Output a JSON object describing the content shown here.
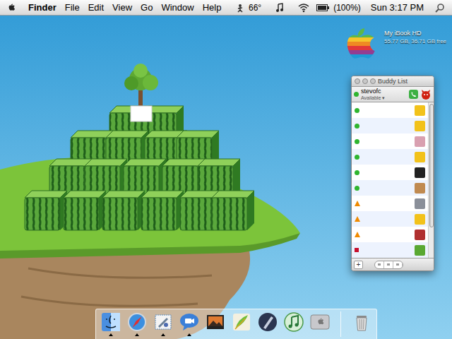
{
  "menu_bar": {
    "app": "Finder",
    "menus": [
      "File",
      "Edit",
      "View",
      "Go",
      "Window",
      "Help"
    ],
    "temperature": "66°",
    "battery": "(100%)",
    "clock": "Sun 3:17 PM"
  },
  "desktop_icons": [
    {
      "label": "My iBook HD",
      "detail": "55.77 GB, 36.71 GB free"
    }
  ],
  "buddy_list": {
    "title": "Buddy List",
    "focused": false,
    "account": {
      "name": "stevofc",
      "status": "Available",
      "status_menu": "▾",
      "color": "#2fb52f"
    },
    "buddies": [
      {
        "kind": "dot",
        "color": "#2fb52f"
      },
      {
        "kind": "dot",
        "color": "#2fb52f"
      },
      {
        "kind": "dot",
        "color": "#2fb52f"
      },
      {
        "kind": "dot",
        "color": "#2fb52f"
      },
      {
        "kind": "dot",
        "color": "#2fb52f"
      },
      {
        "kind": "dot",
        "color": "#2fb52f"
      },
      {
        "kind": "triangle",
        "color": "#f08a00"
      },
      {
        "kind": "triangle",
        "color": "#f08a00"
      },
      {
        "kind": "triangle",
        "color": "#f08a00"
      },
      {
        "kind": "square",
        "color": "#c8102e"
      }
    ],
    "add_button": "+"
  },
  "dock": {
    "items": [
      {
        "kind": "finder",
        "running": true
      },
      {
        "kind": "safari",
        "running": true
      },
      {
        "kind": "mail",
        "running": true
      },
      {
        "kind": "ichat",
        "running": true
      },
      {
        "kind": "iphoto",
        "running": false
      },
      {
        "kind": "feather",
        "running": false
      },
      {
        "kind": "pen",
        "running": false
      },
      {
        "kind": "itunes",
        "running": false
      },
      {
        "kind": "preferences",
        "running": false
      },
      {
        "kind": "trash",
        "running": false
      }
    ]
  }
}
